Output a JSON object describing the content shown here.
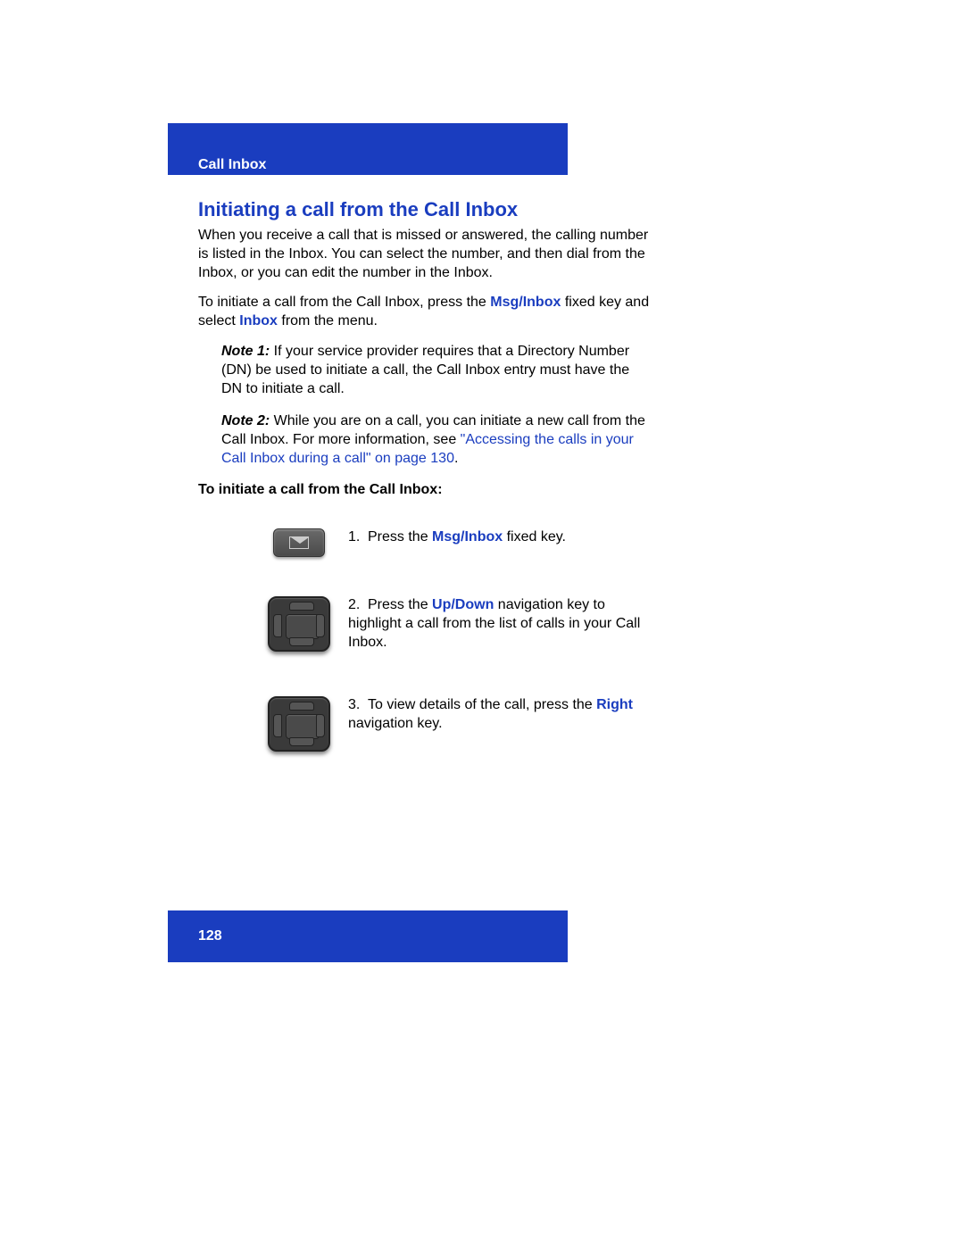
{
  "header": {
    "section": "Call Inbox"
  },
  "heading": "Initiating a call from the Call Inbox",
  "intro1": "When you receive a call that is missed or answered, the calling number is listed in the Inbox. You can select the number, and then dial from the Inbox, or you can edit the number in the Inbox.",
  "intro2_pre": "To initiate a call from the Call Inbox, press the ",
  "intro2_kw": "Msg/Inbox",
  "intro2_mid": " fixed key and select ",
  "intro2_kw2": "Inbox",
  "intro2_post": " from the menu.",
  "note1": {
    "label": "Note 1:",
    "text": "  If your service provider requires that a Directory Number (DN) be used to initiate a call, the Call Inbox entry must have the DN to initiate a call."
  },
  "note2": {
    "label": "Note 2:",
    "text_pre": "  While you are on a call, you can initiate a new call from the Call Inbox. For more information, see ",
    "link": "\"Accessing the calls in your Call Inbox during a call\" on page 130",
    "text_post": "."
  },
  "proc_heading": "To initiate a call from the Call Inbox:",
  "steps": {
    "s1": {
      "num": "1.",
      "pre": "Press the ",
      "kw": "Msg/Inbox",
      "post": " fixed key."
    },
    "s2": {
      "num": "2.",
      "pre": "Press the ",
      "kw": "Up/Down",
      "post": " navigation key to highlight a call from the list of calls in your Call Inbox."
    },
    "s3": {
      "num": "3.",
      "pre": "To view details of the call, press the ",
      "kw": "Right",
      "post": " navigation key."
    }
  },
  "page_number": "128"
}
